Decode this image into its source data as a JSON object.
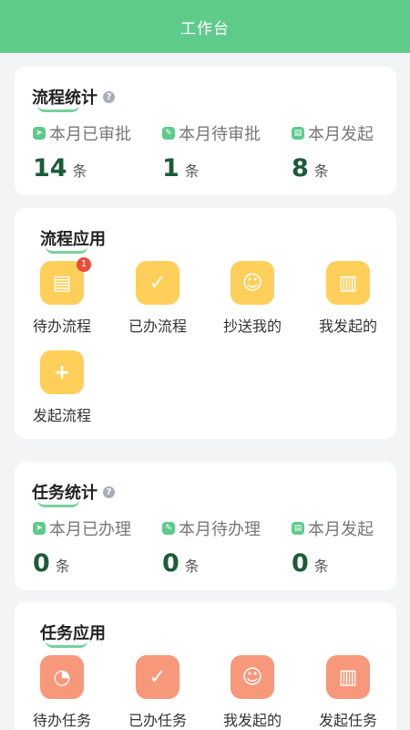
{
  "header": {
    "title": "工作台"
  },
  "process_stats": {
    "title": "流程统计",
    "items": [
      {
        "label": "本月已审批",
        "value": "14",
        "unit": "条",
        "icon": "send-icon"
      },
      {
        "label": "本月待审批",
        "value": "1",
        "unit": "条",
        "icon": "edit-icon"
      },
      {
        "label": "本月发起",
        "value": "8",
        "unit": "条",
        "icon": "doc-icon"
      }
    ]
  },
  "process_apps": {
    "title": "流程应用",
    "items": [
      {
        "label": "待办流程",
        "badge": "1",
        "icon": "pending-doc-icon"
      },
      {
        "label": "已办流程",
        "icon": "done-doc-icon"
      },
      {
        "label": "抄送我的",
        "icon": "cc-user-icon"
      },
      {
        "label": "我发起的",
        "icon": "my-doc-icon"
      },
      {
        "label": "发起流程",
        "icon": "add-doc-icon"
      }
    ]
  },
  "task_stats": {
    "title": "任务统计",
    "items": [
      {
        "label": "本月已办理",
        "value": "0",
        "unit": "条",
        "icon": "send-icon"
      },
      {
        "label": "本月待办理",
        "value": "0",
        "unit": "条",
        "icon": "edit-icon"
      },
      {
        "label": "本月发起",
        "value": "0",
        "unit": "条",
        "icon": "doc-icon"
      }
    ]
  },
  "task_apps": {
    "title": "任务应用",
    "items": [
      {
        "label": "待办任务",
        "icon": "pending-task-icon"
      },
      {
        "label": "已办任务",
        "icon": "done-task-icon"
      },
      {
        "label": "我发起的",
        "icon": "my-task-icon"
      },
      {
        "label": "发起任务",
        "icon": "add-task-icon"
      }
    ]
  },
  "colors": {
    "primary": "#5ecb8b",
    "app_yellow": "#ffcf5a",
    "app_orange": "#f7987a",
    "value_green": "#1c5c38",
    "badge_red": "#f04a3a"
  }
}
